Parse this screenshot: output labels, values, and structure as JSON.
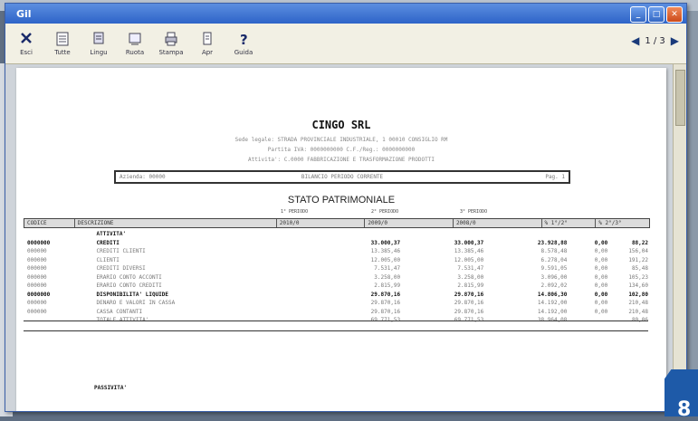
{
  "window": {
    "title": "Gil"
  },
  "toolbar": {
    "buttons": [
      {
        "label": "Esci",
        "icon": "close-x-icon"
      },
      {
        "label": "Tutte",
        "icon": "pages-icon"
      },
      {
        "label": "Lingu",
        "icon": "language-icon"
      },
      {
        "label": "Ruota",
        "icon": "rotate-icon"
      },
      {
        "label": "Stampa",
        "icon": "printer-icon"
      },
      {
        "label": "Apr",
        "icon": "open-icon"
      },
      {
        "label": "Guida",
        "icon": "help-icon"
      }
    ],
    "pager": {
      "prev": "◀",
      "page": "1 / 3",
      "next": "▶"
    }
  },
  "report": {
    "company": "CINGO SRL",
    "sublines": [
      "Sede legale: STRADA PROVINCIALE INDUSTRIALE, 1 00010 CONSIGLIO RM",
      "Partita IVA: 0000000000 C.F./Reg.: 0000000000",
      "Attivita': C.0000 FABBRICAZIONE E TRASFORMAZIONE PRODOTTI"
    ],
    "box_cells": [
      "Azienda: 00000",
      "BILANCIO PERIODO CORRENTE",
      "Pag. 1"
    ],
    "section_title": "STATO PATRIMONIALE",
    "period_labels": [
      "1° PERIODO",
      "2° PERIODO",
      "3° PERIODO"
    ],
    "header": [
      "CODICE",
      "DESCRIZIONE",
      "2010/0",
      "2009/0",
      "2008/0",
      "% 1°/2°",
      "% 2°/3°"
    ],
    "rows": [
      {
        "code": "",
        "desc": "ATTIVITA'",
        "v1": "",
        "v2": "",
        "v3": "",
        "p1": "",
        "p2": "",
        "bold": true
      },
      {
        "code": "0000000",
        "desc": "CREDITI",
        "v1": "33.000,37",
        "v2": "33.000,37",
        "v3": "23.928,88",
        "p1": "0,00",
        "p2": "88,22",
        "bold": true
      },
      {
        "code": "000000",
        "desc": "CREDITI CLIENTI",
        "v1": "13.385,46",
        "v2": "13.385,46",
        "v3": "8.578,48",
        "p1": "0,00",
        "p2": "156,04",
        "bold": false
      },
      {
        "code": "000000",
        "desc": "CLIENTI",
        "v1": "12.005,00",
        "v2": "12.005,00",
        "v3": "6.278,04",
        "p1": "0,00",
        "p2": "191,22",
        "bold": false
      },
      {
        "code": "000000",
        "desc": "CREDITI DIVERSI",
        "v1": "7.531,47",
        "v2": "7.531,47",
        "v3": "9.591,05",
        "p1": "0,00",
        "p2": "85,48",
        "bold": false
      },
      {
        "code": "000000",
        "desc": "ERARIO CONTO ACCONTI",
        "v1": "3.258,00",
        "v2": "3.258,00",
        "v3": "3.096,00",
        "p1": "0,00",
        "p2": "105,23",
        "bold": false
      },
      {
        "code": "000000",
        "desc": "ERARIO CONTO CREDITI",
        "v1": "2.815,99",
        "v2": "2.815,99",
        "v3": "2.092,02",
        "p1": "0,00",
        "p2": "134,60",
        "bold": false
      },
      {
        "code": "0000000",
        "desc": "DISPONIBILITA' LIQUIDE",
        "v1": "29.870,16",
        "v2": "29.870,16",
        "v3": "14.806,30",
        "p1": "0,00",
        "p2": "102,80",
        "bold": true
      },
      {
        "code": "000000",
        "desc": "DENARO E VALORI IN CASSA",
        "v1": "29.870,16",
        "v2": "29.870,16",
        "v3": "14.192,00",
        "p1": "0,00",
        "p2": "210,48",
        "bold": false
      },
      {
        "code": "000000",
        "desc": "CASSA CONTANTI",
        "v1": "29.870,16",
        "v2": "29.870,16",
        "v3": "14.192,00",
        "p1": "0,00",
        "p2": "210,48",
        "bold": false
      },
      {
        "code": "",
        "desc": "TOTALE ATTIVITA'",
        "v1": "69.771,53",
        "v2": "69.771,53",
        "v3": "38.964,08",
        "p1": "",
        "p2": "80,06",
        "bold": false
      }
    ],
    "passivita": "PASSIVITA'"
  },
  "corner": {
    "digit": "8"
  },
  "colors": {
    "titlebar": "#2e64c8",
    "corner": "#1e5aa8"
  }
}
